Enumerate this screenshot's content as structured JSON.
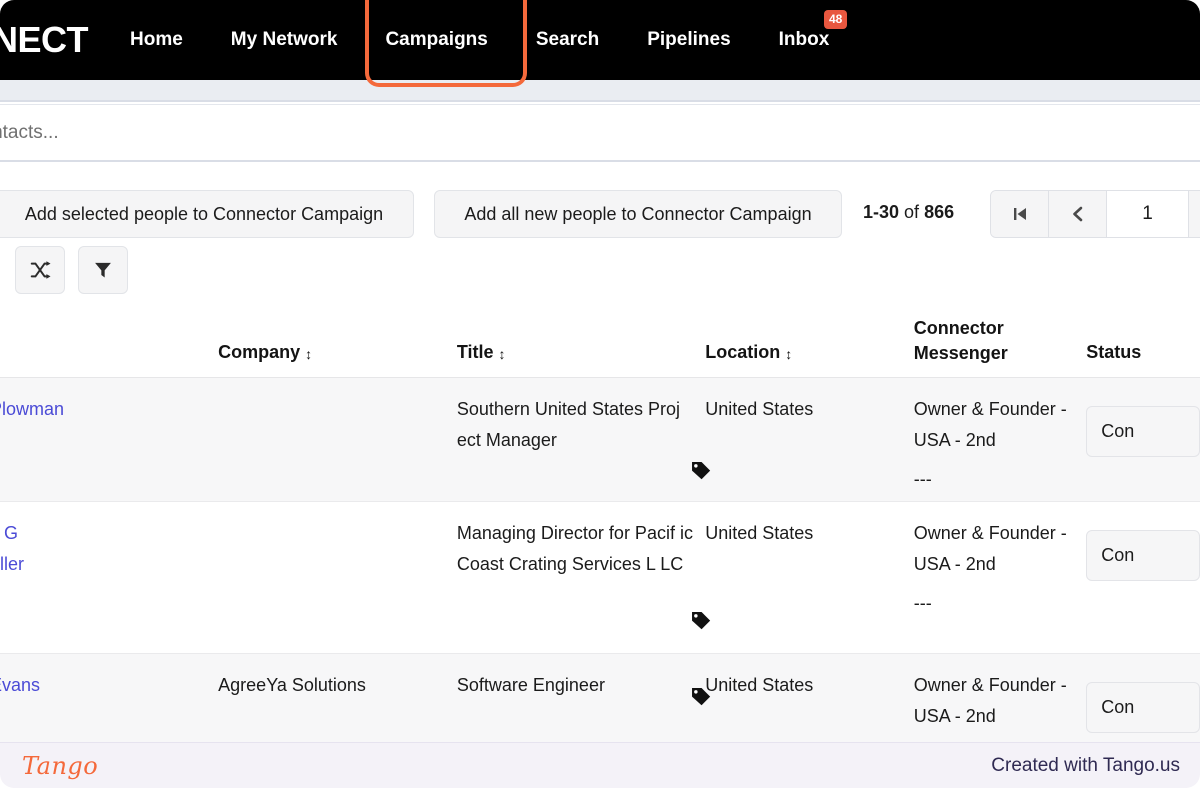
{
  "navbar": {
    "brand": "NECT",
    "items": [
      {
        "label": "Home",
        "badge": null
      },
      {
        "label": "My Network",
        "badge": null
      },
      {
        "label": "Campaigns",
        "badge": null
      },
      {
        "label": "Search",
        "badge": null
      },
      {
        "label": "Pipelines",
        "badge": null
      },
      {
        "label": "Inbox",
        "badge": "48"
      }
    ],
    "highlighted_item": "Campaigns",
    "highlight_color": "#f4693b",
    "badge_color": "#e8573f",
    "background_color": "#000000"
  },
  "search": {
    "value": "",
    "placeholder": "contacts..."
  },
  "toolbar": {
    "add_selected_label": "Add selected people to Connector Campaign",
    "add_all_label": "Add all new people to Connector Campaign",
    "count_range": "1-30",
    "count_of": "of",
    "count_total": "866",
    "page_value": "1",
    "first_page_icon": "first-page-icon",
    "prev_page_icon": "previous-page-icon",
    "shuffle_icon": "shuffle-icon",
    "filter_icon": "filter-funnel-icon"
  },
  "table": {
    "headers": {
      "name": "",
      "company": "Company",
      "title": "Title",
      "location": "Location",
      "connector_line1": "Connector",
      "connector_line2": "Messenger",
      "status": "Status"
    },
    "sort_icon": "sort-updown-icon",
    "rows": [
      {
        "name": "Plowman",
        "company": "",
        "title": "Southern United States Proj ect Manager",
        "location": "United States",
        "connector": "Owner & Founder - USA - 2nd",
        "connector_sub": "---",
        "status_label": "Con",
        "tag_icon": "tag-icon"
      },
      {
        "name": "y G\nller",
        "company": "",
        "title": "Managing Director for Pacif ic Coast Crating Services L LC",
        "location": "United States",
        "connector": "Owner & Founder - USA - 2nd",
        "connector_sub": "---",
        "status_label": "Con",
        "tag_icon": "tag-icon"
      },
      {
        "name": "Evans",
        "company": "AgreeYa Solutions",
        "title": "Software Engineer",
        "location": "United States",
        "connector": "Owner & Founder - USA - 2nd",
        "connector_sub": "",
        "status_label": "Con",
        "tag_icon": "tag-icon"
      }
    ]
  },
  "footer": {
    "logo_text": "Tango",
    "credit": "Created with Tango.us",
    "logo_color": "#f4693b",
    "credit_color": "#2f2a52"
  }
}
